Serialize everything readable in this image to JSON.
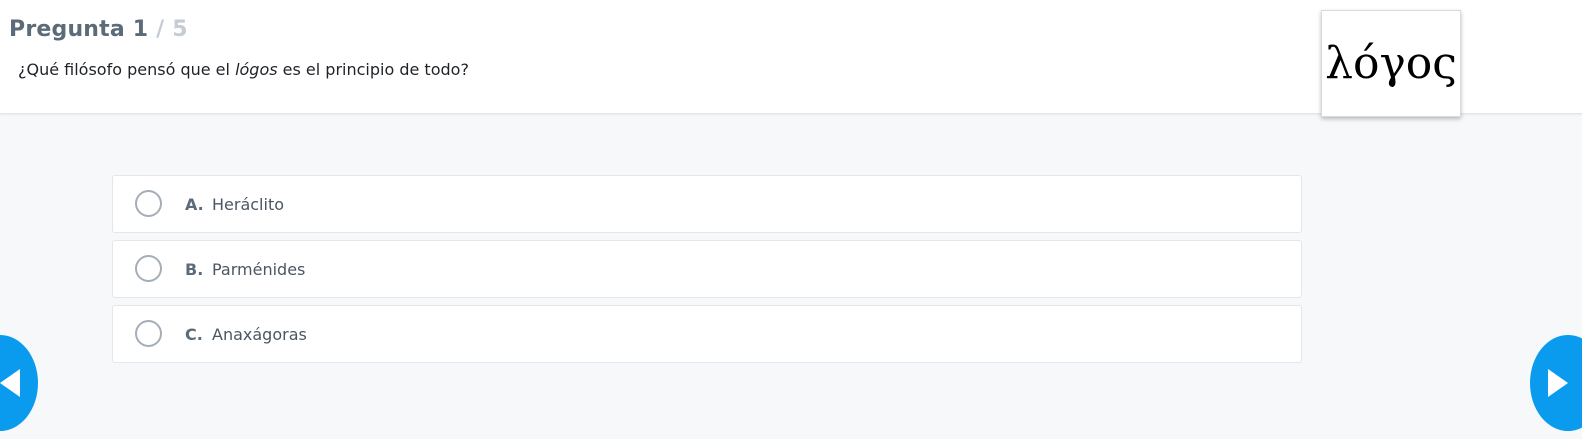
{
  "header": {
    "question_label": "Pregunta",
    "current": "1",
    "separator_total": "/ 5",
    "question_text_before": "¿Qué filósofo pensó que el ",
    "question_text_emph": "lógos",
    "question_text_after": " es el principio de todo?",
    "image_text": "λόγος"
  },
  "options": [
    {
      "letter": "A.",
      "label": "Heráclito"
    },
    {
      "letter": "B.",
      "label": "Parménides"
    },
    {
      "letter": "C.",
      "label": "Anaxágoras"
    }
  ],
  "nav": {
    "prev_icon": "triangle-left-icon",
    "next_icon": "triangle-right-icon"
  },
  "colors": {
    "accent": "#0a9bef",
    "background": "#f7f8fa"
  }
}
